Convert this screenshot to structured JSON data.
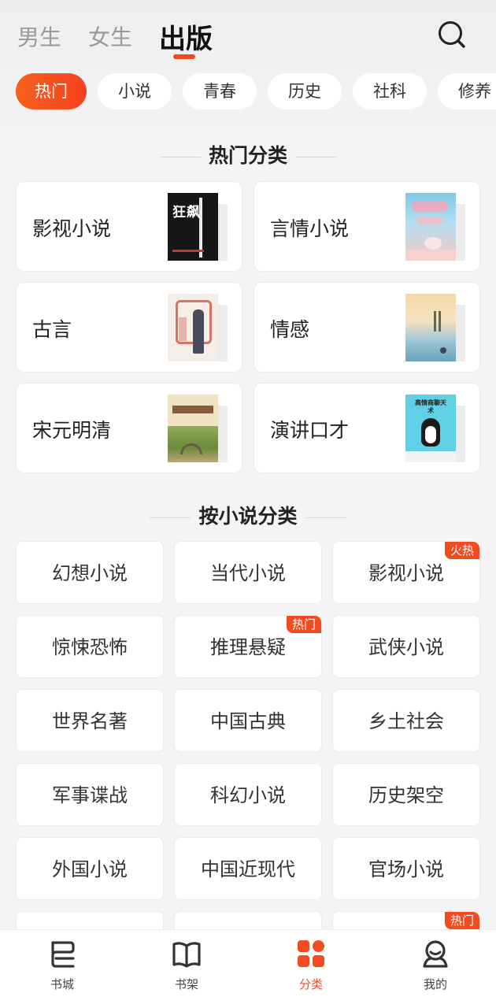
{
  "header": {
    "tabs": [
      {
        "label": "男生",
        "active": false
      },
      {
        "label": "女生",
        "active": false
      },
      {
        "label": "出版",
        "active": true
      }
    ],
    "search_icon": "search-icon",
    "accent_color": "#f24b1f"
  },
  "chips": [
    "热门",
    "小说",
    "青春",
    "历史",
    "社科",
    "修养"
  ],
  "active_chip": "热门",
  "hot_section": {
    "title": "热门分类",
    "items": [
      {
        "label": "影视小说",
        "cover_text": "狂飙"
      },
      {
        "label": "言情小说",
        "cover_text": ""
      },
      {
        "label": "古言",
        "cover_text": ""
      },
      {
        "label": "情感",
        "cover_text": ""
      },
      {
        "label": "宋元明清",
        "cover_text": ""
      },
      {
        "label": "演讲口才",
        "cover_text": "高情商聊天术"
      }
    ]
  },
  "novel_section": {
    "title": "按小说分类",
    "items": [
      {
        "label": "幻想小说",
        "badge": ""
      },
      {
        "label": "当代小说",
        "badge": ""
      },
      {
        "label": "影视小说",
        "badge": "火热"
      },
      {
        "label": "惊悚恐怖",
        "badge": ""
      },
      {
        "label": "推理悬疑",
        "badge": "热门"
      },
      {
        "label": "武侠小说",
        "badge": ""
      },
      {
        "label": "世界名著",
        "badge": ""
      },
      {
        "label": "中国古典",
        "badge": ""
      },
      {
        "label": "乡土社会",
        "badge": ""
      },
      {
        "label": "军事谍战",
        "badge": ""
      },
      {
        "label": "科幻小说",
        "badge": ""
      },
      {
        "label": "历史架空",
        "badge": ""
      },
      {
        "label": "外国小说",
        "badge": ""
      },
      {
        "label": "中国近现代",
        "badge": ""
      },
      {
        "label": "官场小说",
        "badge": ""
      },
      {
        "label": "",
        "badge": ""
      },
      {
        "label": "",
        "badge": ""
      },
      {
        "label": "",
        "badge": "热门"
      }
    ]
  },
  "bottom_nav": [
    {
      "label": "书城",
      "icon": "bookstore-icon",
      "active": false
    },
    {
      "label": "书架",
      "icon": "bookshelf-icon",
      "active": false
    },
    {
      "label": "分类",
      "icon": "category-icon",
      "active": true
    },
    {
      "label": "我的",
      "icon": "profile-icon",
      "active": false
    }
  ]
}
